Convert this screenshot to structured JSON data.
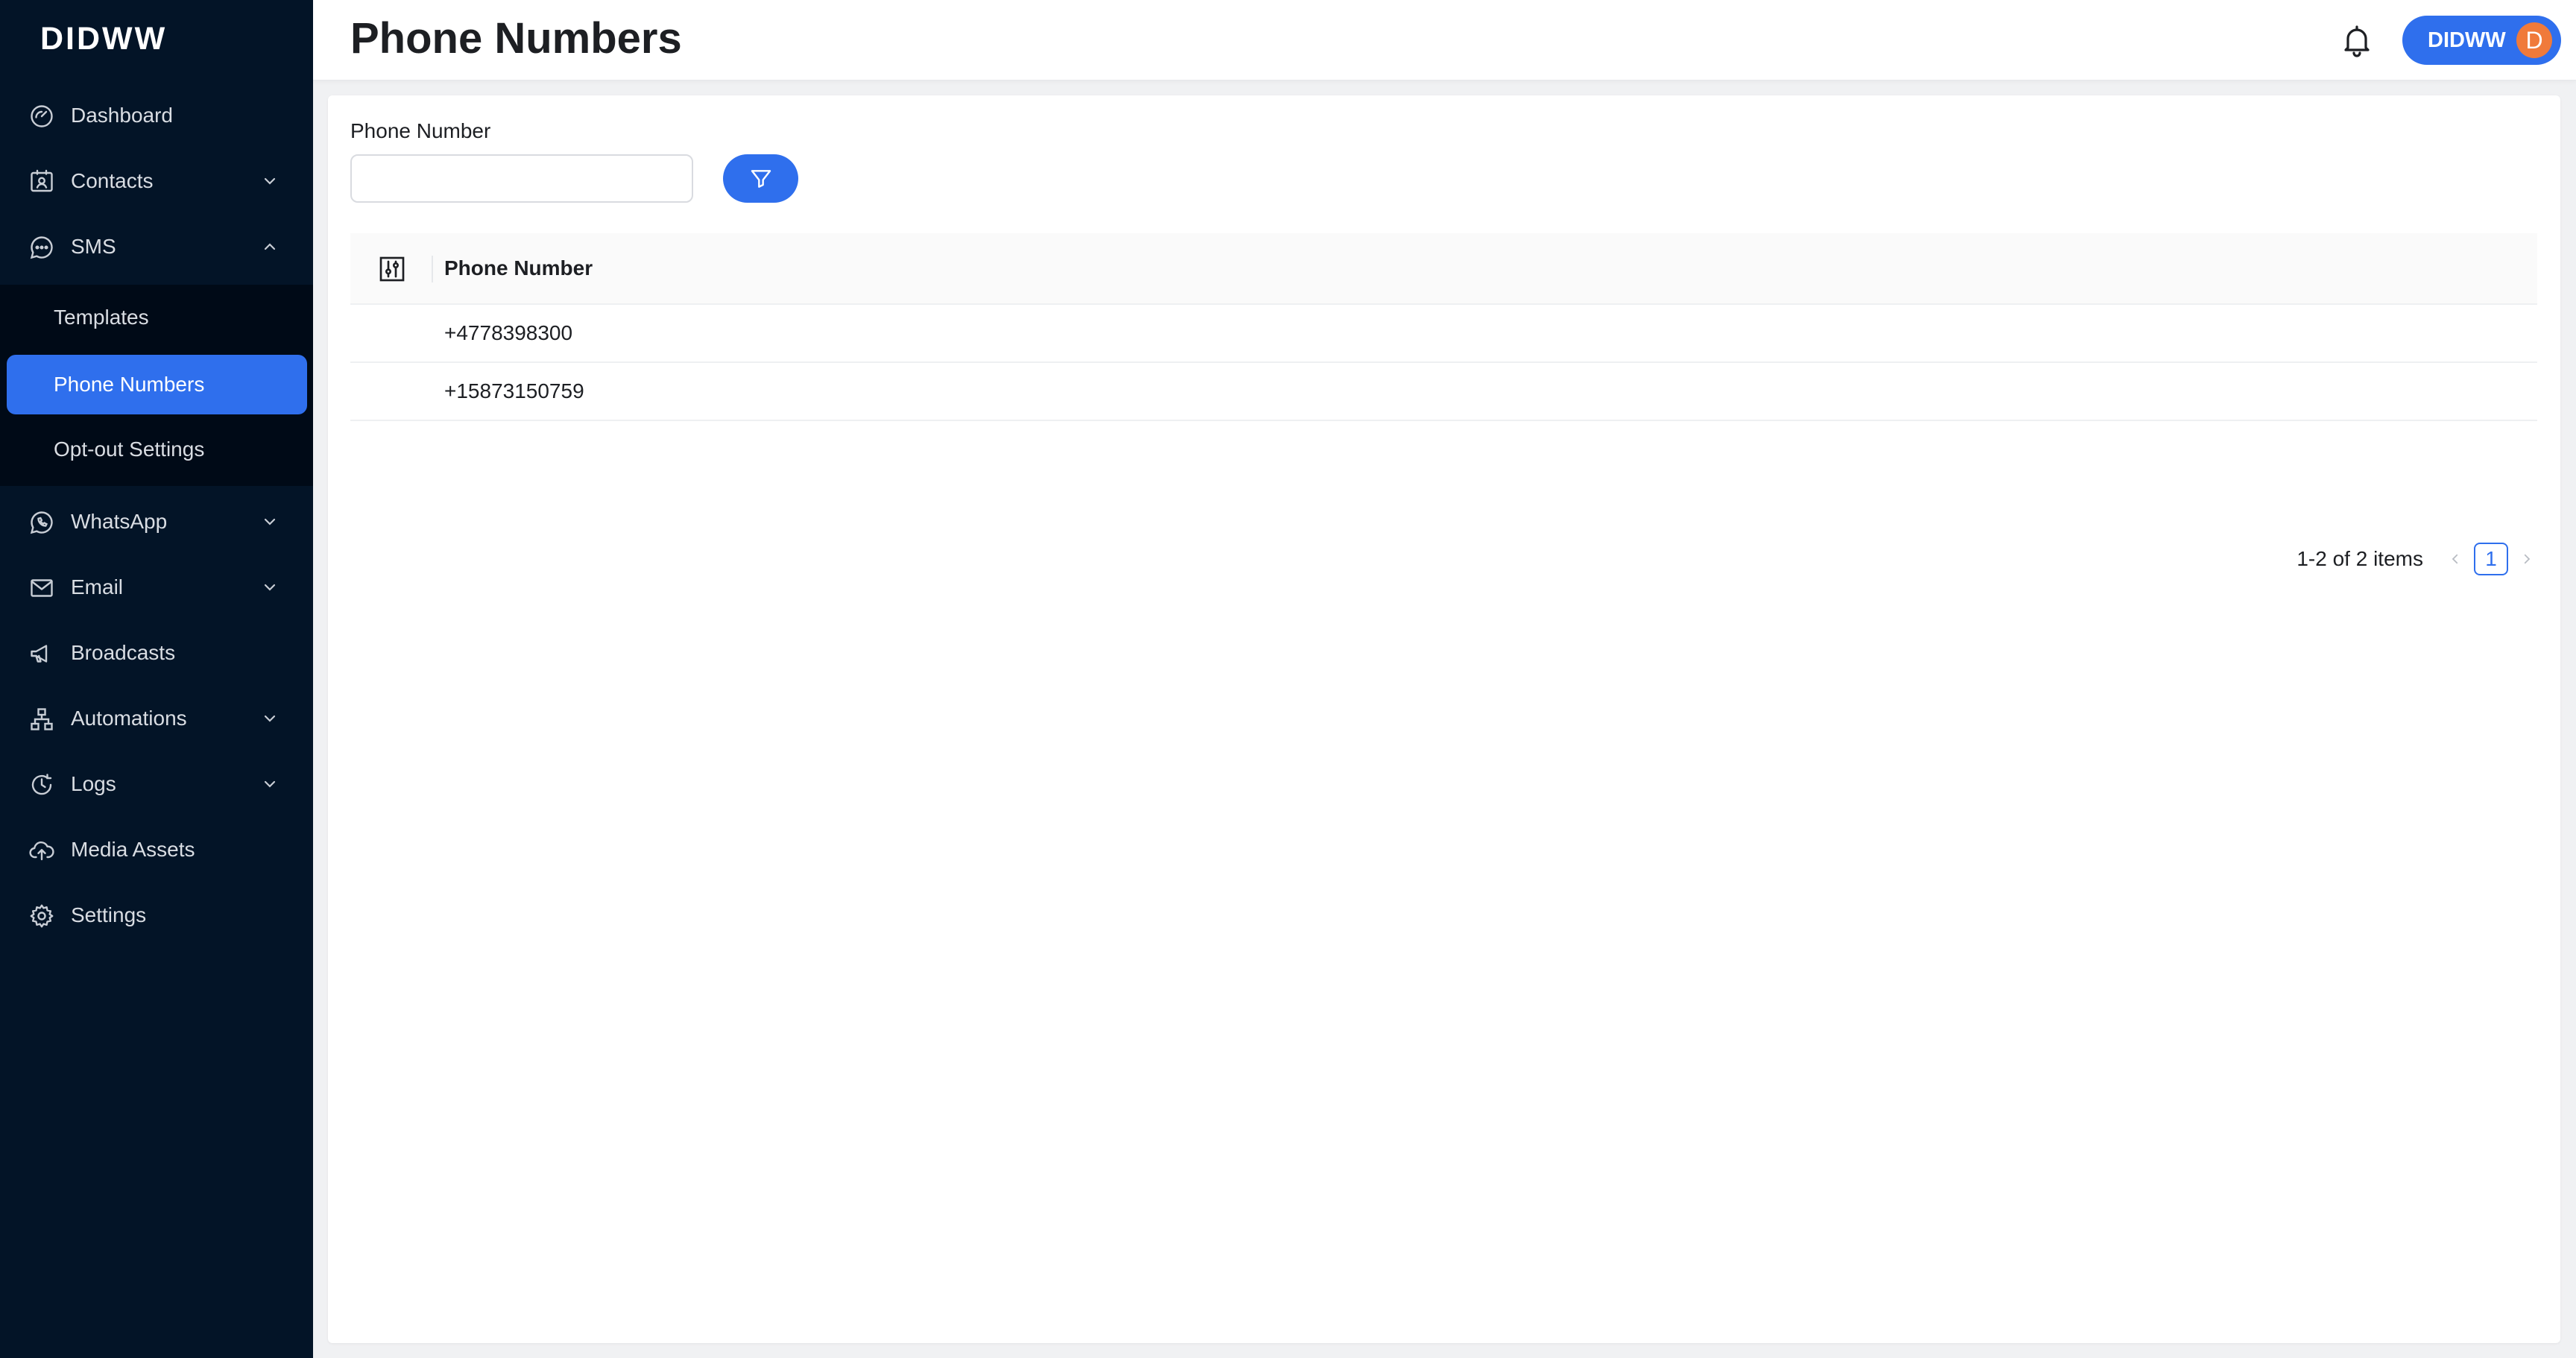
{
  "app": {
    "logo_text": "DIDWW",
    "page_title": "Phone Numbers"
  },
  "sidebar": {
    "items": [
      {
        "label": "Dashboard",
        "icon": "dashboard-icon"
      },
      {
        "label": "Contacts",
        "icon": "contacts-icon",
        "expandable": true
      },
      {
        "label": "SMS",
        "icon": "sms-icon",
        "expandable": true,
        "expanded": true
      },
      {
        "label": "WhatsApp",
        "icon": "whatsapp-icon",
        "expandable": true
      },
      {
        "label": "Email",
        "icon": "email-icon",
        "expandable": true
      },
      {
        "label": "Broadcasts",
        "icon": "broadcast-icon"
      },
      {
        "label": "Automations",
        "icon": "automations-icon",
        "expandable": true
      },
      {
        "label": "Logs",
        "icon": "logs-icon",
        "expandable": true
      },
      {
        "label": "Media Assets",
        "icon": "cloud-upload-icon"
      },
      {
        "label": "Settings",
        "icon": "gear-icon"
      }
    ],
    "sms_submenu": [
      {
        "label": "Templates"
      },
      {
        "label": "Phone Numbers",
        "active": true
      },
      {
        "label": "Opt-out Settings"
      }
    ]
  },
  "header": {
    "user_name": "DIDWW",
    "avatar_initial": "D"
  },
  "filter": {
    "label": "Phone Number",
    "value": "",
    "placeholder": ""
  },
  "table": {
    "columns": [
      "Phone Number"
    ],
    "rows": [
      {
        "phone_number": "+4778398300"
      },
      {
        "phone_number": "+15873150759"
      }
    ]
  },
  "pagination": {
    "range_text": "1-2 of 2 items",
    "current_page": "1"
  },
  "colors": {
    "sidebar_bg": "#031427",
    "submenu_bg": "#000a17",
    "accent": "#2f6fed",
    "avatar": "#f07a3a"
  }
}
